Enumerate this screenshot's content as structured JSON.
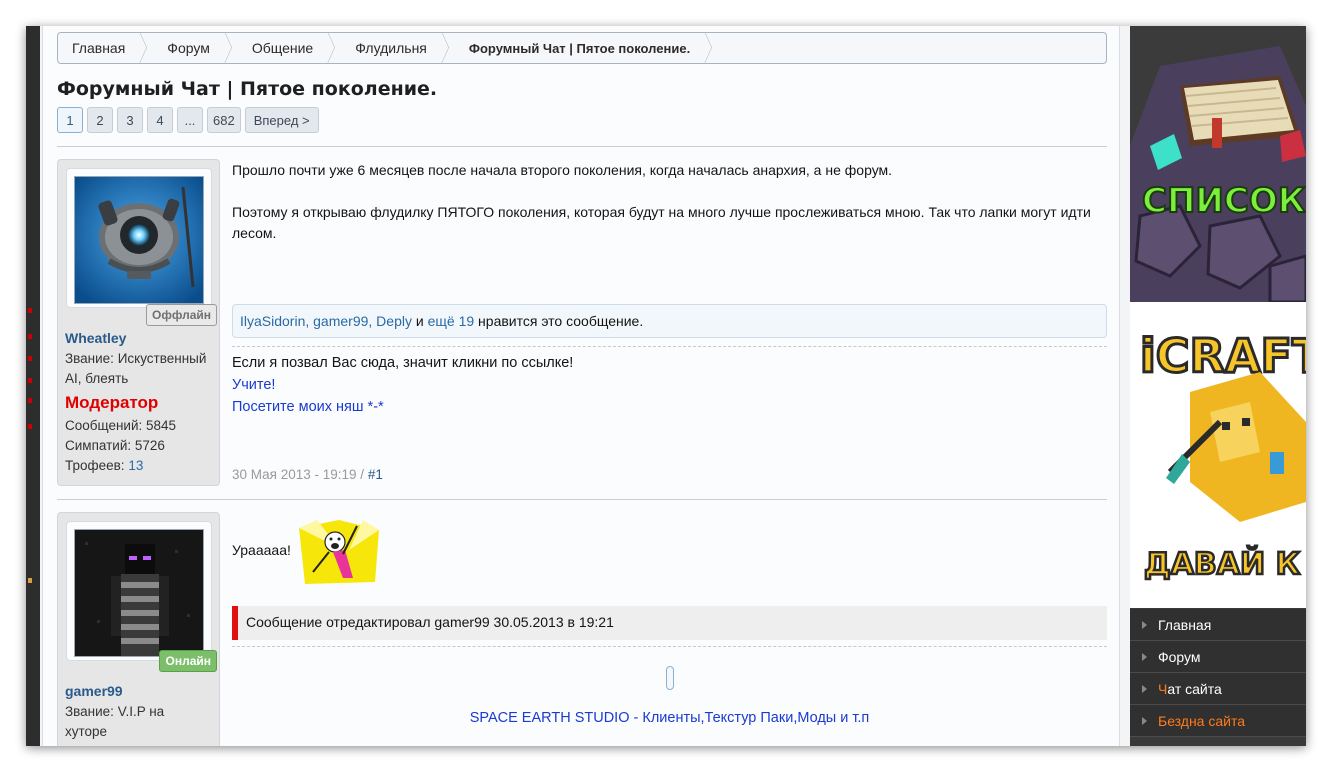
{
  "breadcrumb": [
    "Главная",
    "Форум",
    "Общение",
    "Флудильня",
    "Форумный Чат | Пятое поколение."
  ],
  "thread_title": "Форумный Чат | Пятое поколение.",
  "pager": {
    "pages": [
      "1",
      "2",
      "3",
      "4",
      "...",
      "682"
    ],
    "active": "1",
    "next": "Вперед >"
  },
  "post1": {
    "status": "Оффлайн",
    "username": "Wheatley",
    "title_line1": "Звание: Искуственный",
    "title_line2": "AI, блеять",
    "role": "Модератор",
    "messages": "Сообщений: 5845",
    "likes_count": "Симпатий: 5726",
    "trophies_label": "Трофеев:",
    "trophies_value": "13",
    "para1": "Прошло почти уже 6 месяцев после начала второго поколения, когда началась анархия, а не форум.",
    "para2": "Поэтому я открываю флудилку ПЯТОГО поколения, которая будут на много лучше прослеживаться мною. Так что лапки могут идти лесом.",
    "likes": {
      "names": "IlyaSidorin, gamer99, Deply",
      "and": "и",
      "more": "ещё 19",
      "suffix": "нравится это сообщение."
    },
    "sig1": "Если я позвал Вас сюда, значит кликни по ссылке!",
    "sig2": "Учите!",
    "sig3": "Посетите моих няш *-*",
    "date": "30 Мая 2013 - 19:19 /",
    "num": "#1"
  },
  "post2": {
    "status": "Онлайн",
    "username": "gamer99",
    "title_line1": "Звание: V.I.P на",
    "title_line2": "хуторе",
    "text": "Урааааа!",
    "edited": "Сообщение отредактировал gamer99 30.05.2013 в 19:21",
    "sig_link": "SPACE EARTH STUDIO - Клиенты,Текстур Паки,Моды и т.п"
  },
  "sidebar": {
    "banner1": "СПИСОК СЕРВЕРОВ",
    "banner2_top": "iCRAFT",
    "banner2_bottom": "ДАВАЙ К НАМ",
    "nav": [
      "Главная",
      "Форум",
      "Ч",
      "ат сайта",
      "Бездна сайта"
    ]
  },
  "colors": {
    "role": "#e00000",
    "link": "#2a6aa5",
    "edited_bar": "#e01010",
    "nav_accent": "#ff7a1a"
  }
}
